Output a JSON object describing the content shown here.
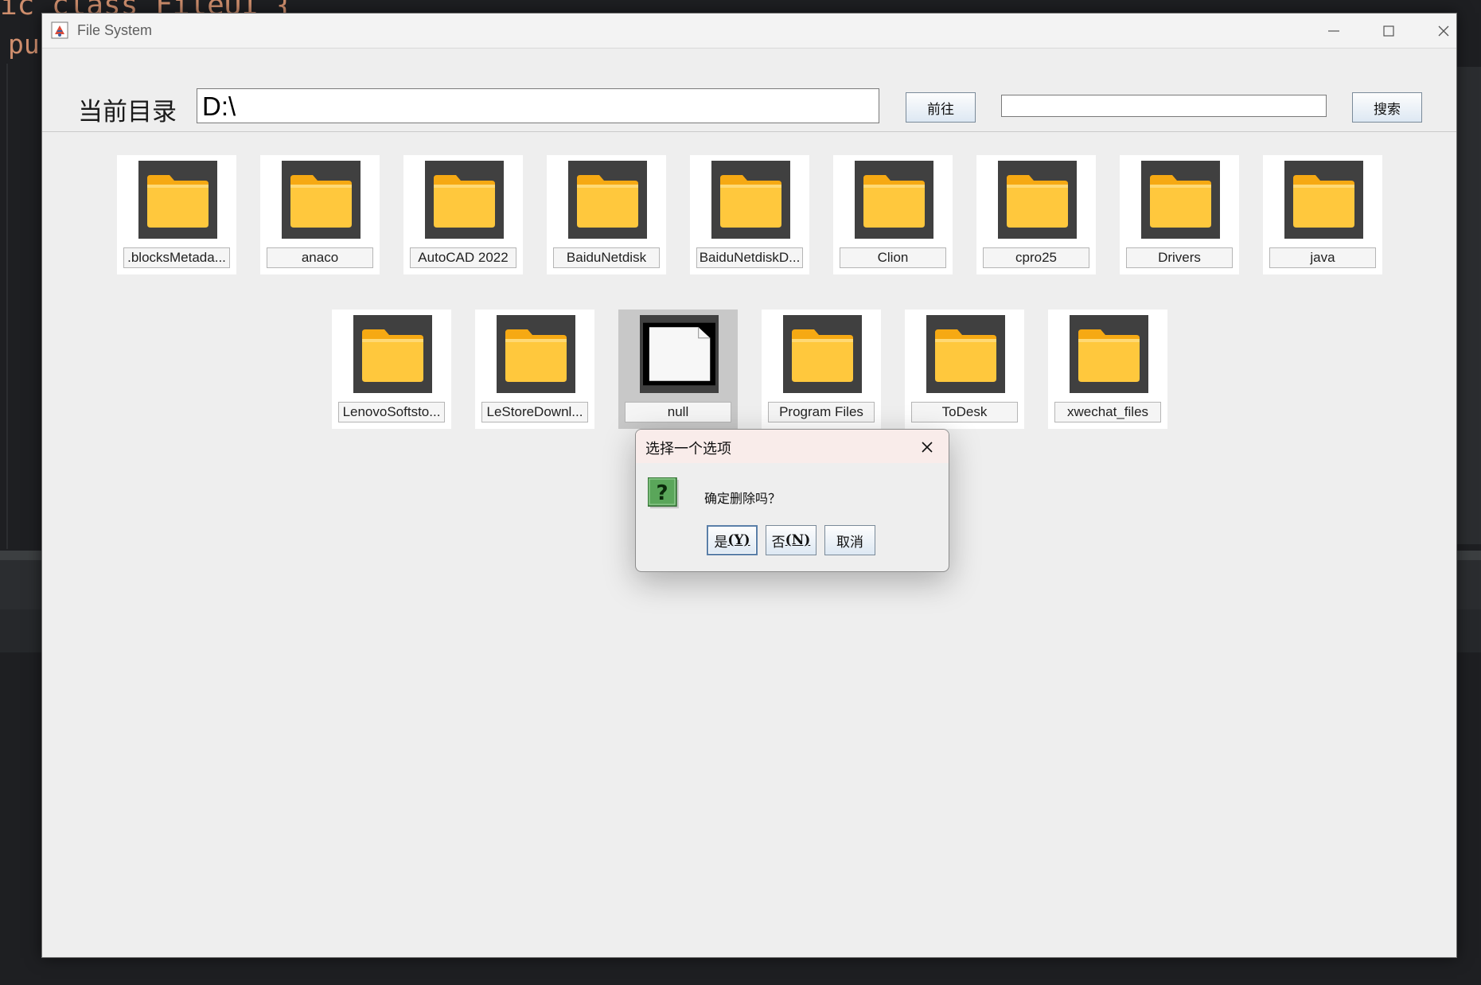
{
  "ide": {
    "code_line_1": "ic class FileUI {",
    "code_line_2": "pu"
  },
  "window": {
    "title": "File System",
    "controls": {
      "minimize": "minimize-icon",
      "maximize": "maximize-icon",
      "close": "close-icon"
    }
  },
  "toolbar": {
    "dir_label": "当前目录",
    "path_value": "D:\\",
    "go_label": "前往",
    "search_value": "",
    "search_label": "搜索"
  },
  "files": [
    {
      "name": ".blocksMetada...",
      "type": "folder"
    },
    {
      "name": "anaco",
      "type": "folder"
    },
    {
      "name": "AutoCAD 2022",
      "type": "folder"
    },
    {
      "name": "BaiduNetdisk",
      "type": "folder"
    },
    {
      "name": "BaiduNetdiskD...",
      "type": "folder"
    },
    {
      "name": "Clion",
      "type": "folder"
    },
    {
      "name": "cpro25",
      "type": "folder"
    },
    {
      "name": "Drivers",
      "type": "folder"
    },
    {
      "name": "java",
      "type": "folder"
    },
    {
      "name": "LenovoSoftsto...",
      "type": "folder"
    },
    {
      "name": "LeStoreDownl...",
      "type": "folder"
    },
    {
      "name": "null",
      "type": "file",
      "selected": true
    },
    {
      "name": "Program Files",
      "type": "folder"
    },
    {
      "name": "ToDesk",
      "type": "folder"
    },
    {
      "name": "xwechat_files",
      "type": "folder"
    }
  ],
  "dialog": {
    "title": "选择一个选项",
    "message": "确定删除吗？",
    "icon": "question-icon",
    "yes_text": "是",
    "yes_mnemonic": "(Y)",
    "no_text": "否",
    "no_mnemonic": "(N)",
    "cancel_label": "取消"
  },
  "colors": {
    "folder_body": "#ffc83d",
    "folder_tab": "#f6a913",
    "thumb_bg": "#404040",
    "question_icon_bg": "#5aa65a"
  }
}
